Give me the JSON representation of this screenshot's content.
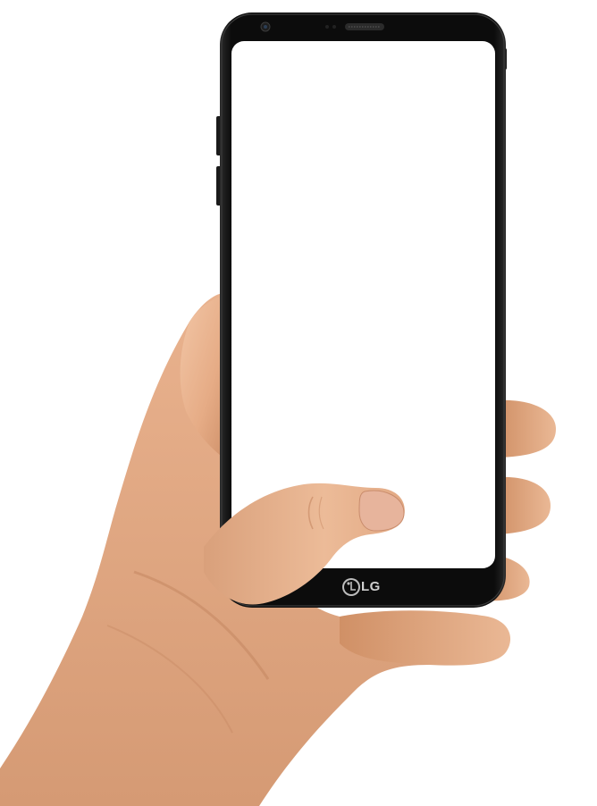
{
  "phone": {
    "brand": "LG",
    "screen_color": "#ffffff",
    "body_color": "#0b0b0b",
    "bezel_color": "#151515"
  },
  "hand": {
    "skin_base": "#e8b08c",
    "skin_shadow": "#c98a63",
    "skin_highlight": "#f4cfb2",
    "nail": "#e9b9a3"
  },
  "icons": {
    "logo": "lg-logo-icon",
    "camera": "front-camera-icon",
    "speaker": "earpiece-speaker-icon"
  }
}
